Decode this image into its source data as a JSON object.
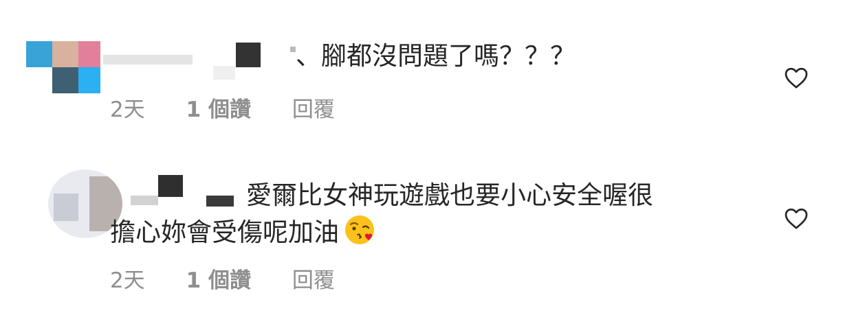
{
  "comments": [
    {
      "text_lines": [
        "、腳都沒問題了嗎？？？"
      ],
      "time": "2天",
      "likes": "1 個讚",
      "reply": "回覆"
    },
    {
      "text_lines": [
        "愛爾比女神玩遊戲也要小心安全喔很",
        "擔心妳會受傷呢加油"
      ],
      "emoji": "kissing-face-with-heart-emoji",
      "time": "2天",
      "likes": "1 個讚",
      "reply": "回覆"
    }
  ],
  "icons": {
    "like": "heart-outline-icon"
  },
  "colors": {
    "text": "#262626",
    "meta": "#8e8e8e",
    "icon": "#262626"
  }
}
